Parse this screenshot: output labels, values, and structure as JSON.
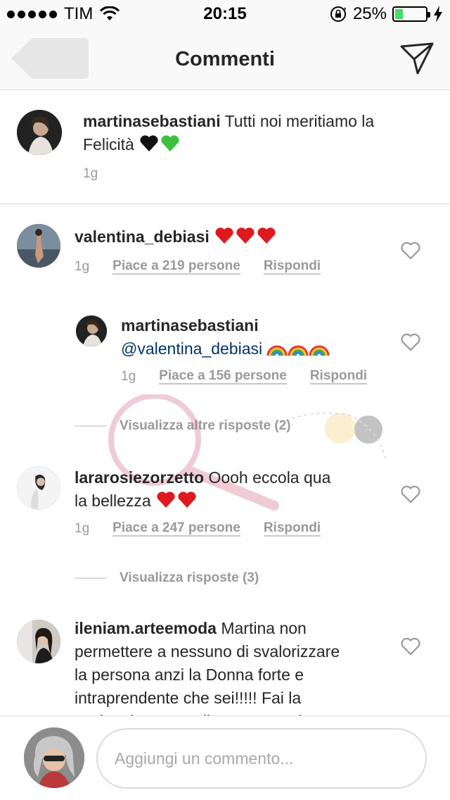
{
  "status_bar": {
    "carrier": "TIM",
    "time": "20:15",
    "battery_percent": "25%",
    "battery_level": 0.25,
    "battery_color": "#4cd964"
  },
  "nav": {
    "title": "Commenti",
    "back_icon": "back-arrow-icon",
    "send_icon": "send-paper-plane-icon"
  },
  "caption": {
    "username": "martinasebastiani",
    "text": "Tutti noi meritiamo la Felicità",
    "emojis": [
      "black-heart",
      "green-heart"
    ],
    "age": "1g"
  },
  "comments": [
    {
      "username": "valentina_debiasi",
      "text": "",
      "emojis": [
        "red-heart",
        "red-heart",
        "red-heart"
      ],
      "age": "1g",
      "likes": "Piace a 219 persone",
      "reply": "Rispondi"
    },
    {
      "username": "martinasebastiani",
      "mention": "@valentina_debiasi",
      "emojis": [
        "rainbow",
        "rainbow",
        "rainbow"
      ],
      "age": "1g",
      "likes": "Piace a 156 persone",
      "reply": "Rispondi"
    },
    {
      "username": "lararosiezorzetto",
      "text": "Oooh eccola qua",
      "text2": "la bellezza",
      "emojis": [
        "red-heart",
        "red-heart"
      ],
      "age": "1g",
      "likes": "Piace a 247 persone",
      "reply": "Rispondi"
    },
    {
      "username": "ileniam.arteemoda",
      "text_line1": "Martina non",
      "text_line2": "permettere a nessuno di svalorizzare",
      "text_line3": "la persona anzi la Donna forte e",
      "text_line4": "intraprendente che sei!!!!! Fai la",
      "text_line5": "scelta giusta scegli te stessa prima"
    }
  ],
  "view_more_replies_1": "Visualizza altre risposte (2)",
  "view_more_replies_2": "Visualizza risposte (3)",
  "bottom": {
    "placeholder": "Aggiungi un commento..."
  },
  "colors": {
    "mention": "#003569",
    "meta": "#999999",
    "divider": "#dbdbdb"
  }
}
